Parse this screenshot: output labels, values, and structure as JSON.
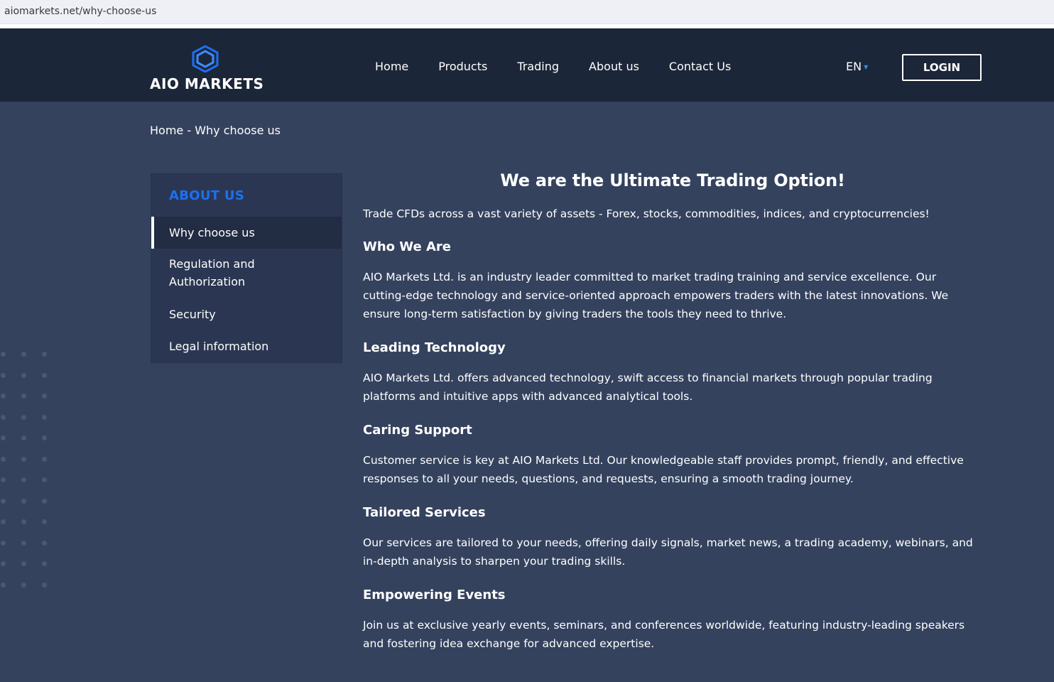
{
  "browser": {
    "url": "aiomarkets.net/why-choose-us"
  },
  "header": {
    "logo_text": "AIO MARKETS",
    "nav": [
      "Home",
      "Products",
      "Trading",
      "About us",
      "Contact Us"
    ],
    "lang": "EN",
    "login_label": "LOGIN",
    "colors": {
      "header_bg": "#1c2639",
      "accent": "#1d6ff2"
    }
  },
  "breadcrumb": {
    "home": "Home",
    "separator": " - ",
    "current": "Why choose us"
  },
  "sidebar": {
    "title": "ABOUT US",
    "items": [
      {
        "label": "Why choose us",
        "active": true
      },
      {
        "label": "Regulation and Authorization",
        "active": false
      },
      {
        "label": "Security",
        "active": false
      },
      {
        "label": "Legal information",
        "active": false
      }
    ]
  },
  "main": {
    "title": "We are the Ultimate Trading Option!",
    "intro": "Trade CFDs across a vast variety of assets - Forex, stocks, commodities, indices, and cryptocurrencies!",
    "sections": [
      {
        "heading": "Who We Are",
        "body": "AIO Markets Ltd. is an industry leader committed to market trading training and service excellence. Our cutting-edge technology and service-oriented approach empowers traders with the latest innovations. We ensure long-term satisfaction by giving traders the tools they need to thrive."
      },
      {
        "heading": "Leading Technology",
        "body": "AIO Markets Ltd. offers advanced technology, swift access to financial markets through popular trading platforms and intuitive apps with advanced analytical tools."
      },
      {
        "heading": "Caring Support",
        "body": "Customer service is key at AIO Markets Ltd. Our knowledgeable staff provides prompt, friendly, and effective responses to all your needs, questions, and requests, ensuring a smooth trading journey."
      },
      {
        "heading": "Tailored Services",
        "body": "Our services are tailored to your needs, offering daily signals, market news, a trading academy, webinars, and in-depth analysis to sharpen your trading skills."
      },
      {
        "heading": "Empowering Events",
        "body": "Join us at exclusive yearly events, seminars, and conferences worldwide, featuring industry-leading speakers and fostering idea exchange for advanced expertise."
      }
    ]
  }
}
